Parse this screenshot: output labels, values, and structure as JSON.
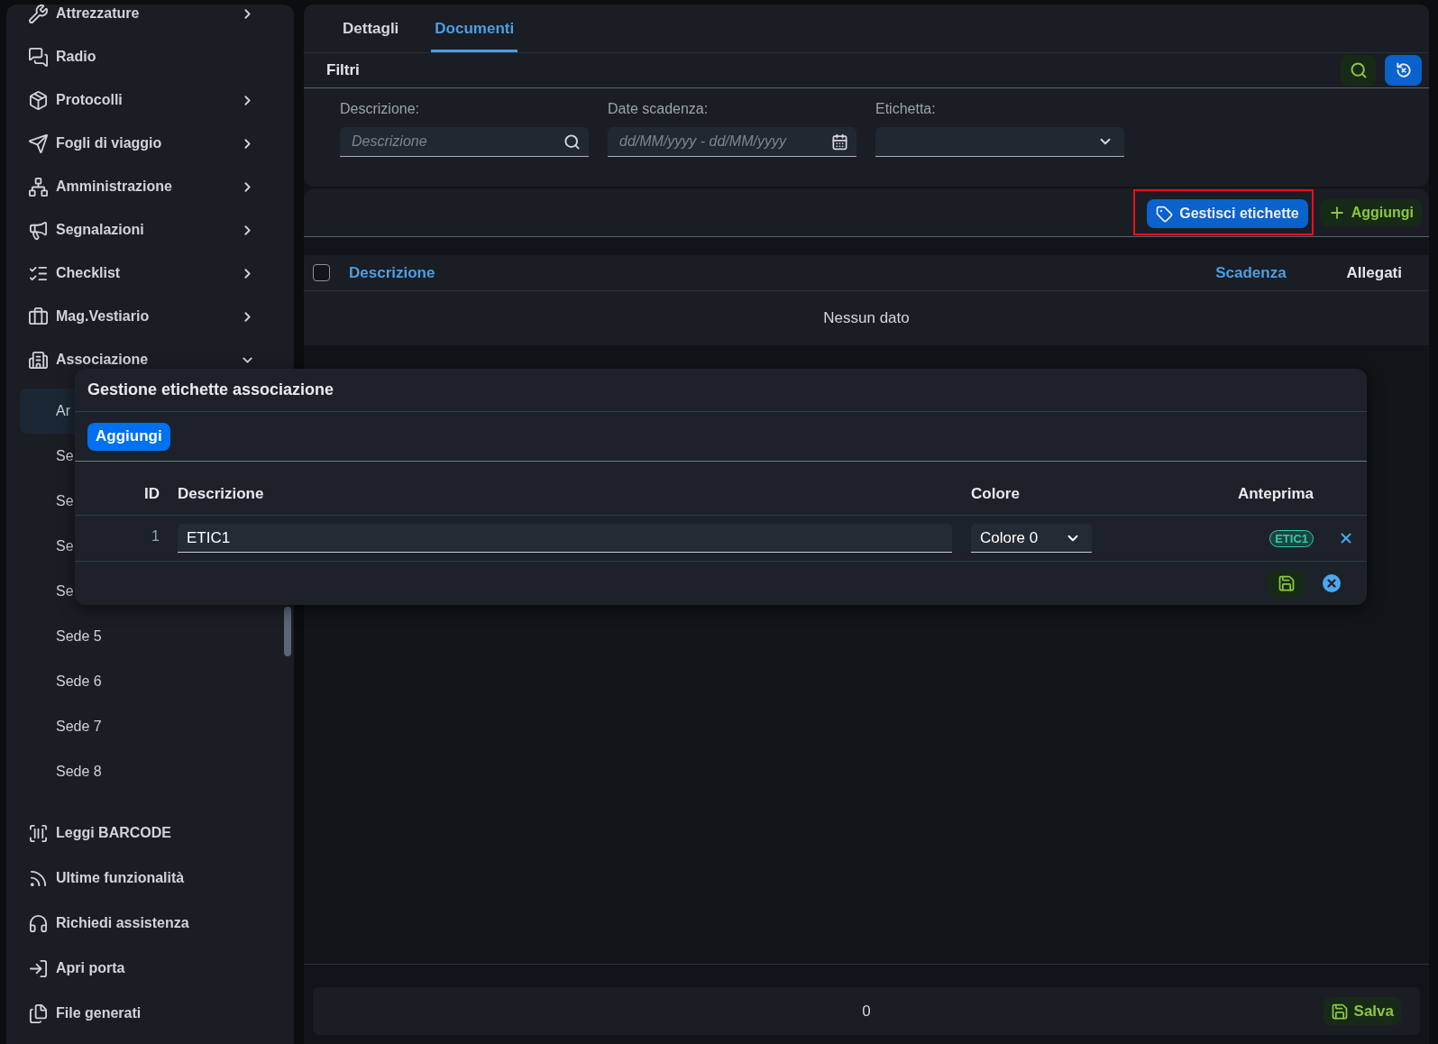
{
  "sidebar": {
    "items": [
      {
        "label": "Attrezzature",
        "expanded": false
      },
      {
        "label": "Radio"
      },
      {
        "label": "Protocolli",
        "expanded": false
      },
      {
        "label": "Fogli di viaggio",
        "expanded": false
      },
      {
        "label": "Amministrazione",
        "expanded": false
      },
      {
        "label": "Segnalazioni",
        "expanded": false
      },
      {
        "label": "Checklist",
        "expanded": false
      },
      {
        "label": "Mag.Vestiario",
        "expanded": false
      },
      {
        "label": "Associazione",
        "expanded": true,
        "children": [
          {
            "label": "Ar",
            "selected": true
          },
          {
            "label": "Se",
            "selected": false
          },
          {
            "label": "Se",
            "selected": false
          },
          {
            "label": "Se",
            "selected": false
          },
          {
            "label": "Se",
            "selected": false
          },
          {
            "label": "Sede 5",
            "selected": false
          },
          {
            "label": "Sede 6",
            "selected": false
          },
          {
            "label": "Sede 7",
            "selected": false
          },
          {
            "label": "Sede 8",
            "selected": false
          }
        ]
      }
    ],
    "footer_items": [
      {
        "label": "Leggi BARCODE"
      },
      {
        "label": "Ultime funzionalità"
      },
      {
        "label": "Richiedi assistenza"
      },
      {
        "label": "Apri porta"
      },
      {
        "label": "File generati"
      }
    ]
  },
  "tabs": [
    {
      "label": "Dettagli",
      "selected": false
    },
    {
      "label": "Documenti",
      "selected": true
    }
  ],
  "filters": {
    "title": "Filtri",
    "fields": [
      {
        "kind": "text",
        "label": "Descrizione:",
        "placeholder": "Descrizione"
      },
      {
        "kind": "daterange",
        "label": "Date scadenza:",
        "placeholder": "dd/MM/yyyy - dd/MM/yyyy"
      },
      {
        "kind": "select",
        "label": "Etichetta:"
      }
    ]
  },
  "toolbar": {
    "buttons": [
      {
        "kind": "tags",
        "label": "Gestisci etichette",
        "highlighted": true
      },
      {
        "kind": "add",
        "label": "Aggiungi",
        "highlighted": false
      }
    ]
  },
  "table": {
    "select_all": {
      "checked": false
    },
    "columns": [
      {
        "label": "Descrizione",
        "sortable": true
      },
      {
        "label": "Scadenza",
        "sortable": true
      },
      {
        "label": "Allegati",
        "sortable": false
      }
    ],
    "empty_text": "Nessun dato"
  },
  "footer": {
    "count": "0",
    "save_button": "Salva"
  },
  "dialog": {
    "title": "Gestione etichette associazione",
    "add_button": "Aggiungi",
    "columns": [
      {
        "label": "ID"
      },
      {
        "label": "Descrizione"
      },
      {
        "label": "Colore"
      },
      {
        "label": "Anteprima"
      }
    ],
    "rows": [
      {
        "id": "1",
        "description": "ETIC1",
        "color_name": "Colore 0",
        "preview": "ETIC1",
        "color": "#2ad1a8"
      }
    ]
  }
}
